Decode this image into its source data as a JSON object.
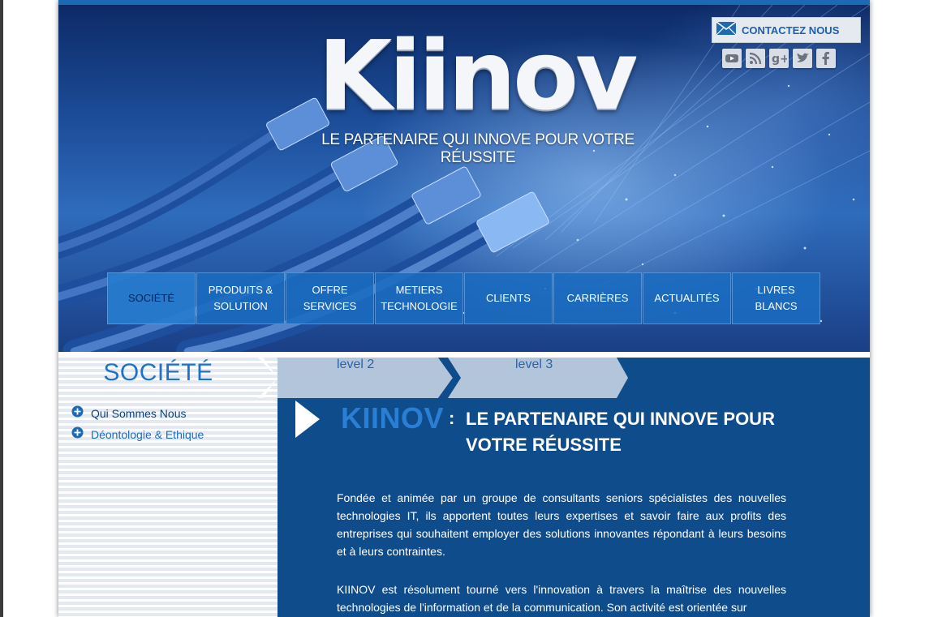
{
  "header": {
    "logo_text": "Kiinov",
    "tagline": "LE PARTENAIRE QUI INNOVE POUR VOTRE RÉUSSITE",
    "contact_label": "CONTACTEZ NOUS",
    "socials": [
      "youtube-icon",
      "rss-icon",
      "google-plus-icon",
      "twitter-icon",
      "facebook-icon"
    ]
  },
  "nav": {
    "items": [
      {
        "label": "SOCIÉTÉ",
        "active": true
      },
      {
        "label": "PRODUITS & SOLUTION"
      },
      {
        "label": "OFFRE SERVICES"
      },
      {
        "label": "METIERS TECHNOLOGIE"
      },
      {
        "label": "CLIENTS"
      },
      {
        "label": "CARRIÈRES"
      },
      {
        "label": "ACTUALITÉS"
      },
      {
        "label": "LIVRES BLANCS"
      }
    ]
  },
  "sidebar": {
    "title": "SOCIÉTÉ",
    "items": [
      {
        "label": "Qui Sommes Nous"
      },
      {
        "label": "Déontologie & Ethique"
      }
    ]
  },
  "breadcrumb": {
    "level2": "level 2",
    "level3": "level 3"
  },
  "main": {
    "brand": "KIINOV",
    "colon": ":",
    "tagline": "LE PARTENAIRE QUI INNOVE POUR VOTRE RÉUSSITE",
    "paragraphs": [
      "Fondée et animée par un groupe de consultants seniors spécialistes des nouvelles technologies IT, ils apportent toutes leurs expertises et savoir faire aux profits des entreprises qui souhaitent employer des solutions innovantes répondant à leurs besoins et à leurs contraintes.",
      "KIINOV est résolument tourné vers l'innovation à travers la maîtrise des nouvelles technologies de l'information et de la communication. Son activité est orientée sur"
    ]
  },
  "colors": {
    "accent": "#1c73c8",
    "main_bg": "#0f4c8b",
    "nav_bg": "#1a6cc0"
  }
}
